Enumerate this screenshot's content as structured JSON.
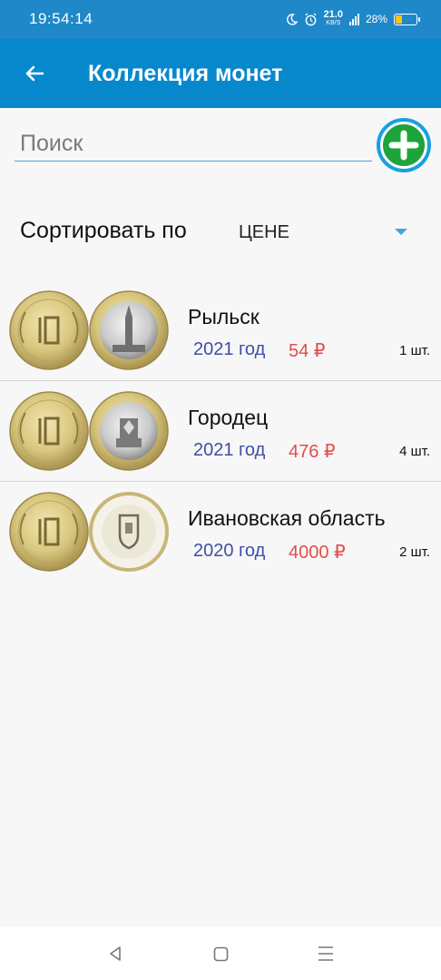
{
  "status_bar": {
    "time": "19:54:14",
    "net_speed": "21.0",
    "net_unit": "KB/S",
    "battery": "28%",
    "battery_level": 0.28,
    "icons": [
      "moon-icon",
      "alarm-icon",
      "signal-icon",
      "battery-icon"
    ]
  },
  "app_bar": {
    "title": "Коллекция монет",
    "back_icon": "arrow-left-icon"
  },
  "search": {
    "placeholder": "Поиск",
    "value": ""
  },
  "add_button": {
    "icon": "plus-icon"
  },
  "sort": {
    "label": "Сортировать по",
    "value": "ЦЕНЕ"
  },
  "coins": [
    {
      "name": "Рыльск",
      "year": "2021 год",
      "price": "54 ₽",
      "qty": "1 шт."
    },
    {
      "name": "Городец",
      "year": "2021 год",
      "price": "476 ₽",
      "qty": "4 шт."
    },
    {
      "name": "Ивановская область",
      "year": "2020 год",
      "price": "4000 ₽",
      "qty": "2 шт."
    }
  ],
  "colors": {
    "status_bar": "#1e88c9",
    "app_bar": "#0888cc",
    "year": "#3f4fa5",
    "price": "#e24c4c",
    "add_button": "#1da43a"
  },
  "nav_icons": [
    "back-triangle-icon",
    "home-square-icon",
    "menu-lines-icon"
  ]
}
